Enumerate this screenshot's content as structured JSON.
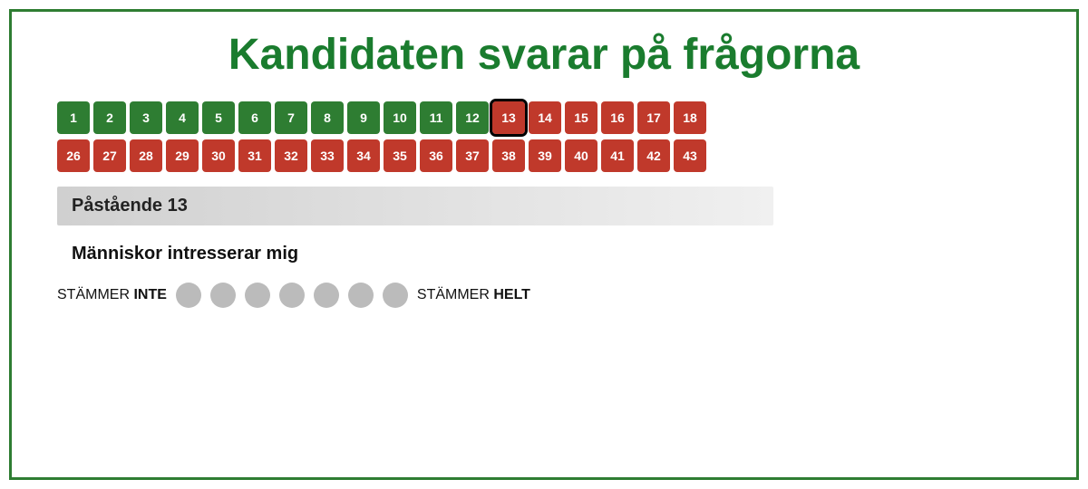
{
  "title": "Kandidaten svarar på frågorna",
  "row1": [
    {
      "num": 1,
      "color": "green"
    },
    {
      "num": 2,
      "color": "green"
    },
    {
      "num": 3,
      "color": "green"
    },
    {
      "num": 4,
      "color": "green"
    },
    {
      "num": 5,
      "color": "green"
    },
    {
      "num": 6,
      "color": "green"
    },
    {
      "num": 7,
      "color": "green"
    },
    {
      "num": 8,
      "color": "green"
    },
    {
      "num": 9,
      "color": "green"
    },
    {
      "num": 10,
      "color": "green"
    },
    {
      "num": 11,
      "color": "green"
    },
    {
      "num": 12,
      "color": "green"
    },
    {
      "num": 13,
      "color": "active-red"
    },
    {
      "num": 14,
      "color": "red"
    },
    {
      "num": 15,
      "color": "red"
    },
    {
      "num": 16,
      "color": "red"
    },
    {
      "num": 17,
      "color": "red"
    },
    {
      "num": 18,
      "color": "red"
    }
  ],
  "row2": [
    {
      "num": 26,
      "color": "red"
    },
    {
      "num": 27,
      "color": "red"
    },
    {
      "num": 28,
      "color": "red"
    },
    {
      "num": 29,
      "color": "red"
    },
    {
      "num": 30,
      "color": "red"
    },
    {
      "num": 31,
      "color": "red"
    },
    {
      "num": 32,
      "color": "red"
    },
    {
      "num": 33,
      "color": "red"
    },
    {
      "num": 34,
      "color": "red"
    },
    {
      "num": 35,
      "color": "red"
    },
    {
      "num": 36,
      "color": "red"
    },
    {
      "num": 37,
      "color": "red"
    },
    {
      "num": 38,
      "color": "red"
    },
    {
      "num": 39,
      "color": "red"
    },
    {
      "num": 40,
      "color": "red"
    },
    {
      "num": 41,
      "color": "red"
    },
    {
      "num": 42,
      "color": "red"
    },
    {
      "num": 43,
      "color": "red"
    }
  ],
  "statement_label": "Påstående 13",
  "question_text": "Människor intresserar mig",
  "scale": {
    "left_normal": "STÄMMER ",
    "left_bold": "INTE",
    "right_normal": "STÄMMER ",
    "right_bold": "HELT",
    "options": [
      1,
      2,
      3,
      4,
      5,
      6,
      7
    ]
  }
}
